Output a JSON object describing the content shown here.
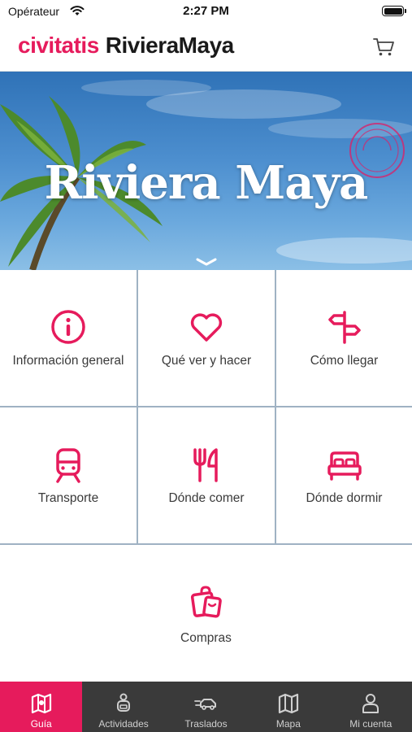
{
  "status_bar": {
    "carrier": "Opérateur",
    "time": "2:27 PM"
  },
  "header": {
    "brand": "civitatis",
    "destination": "RivieraMaya"
  },
  "hero": {
    "title": "Riviera Maya"
  },
  "menu": [
    {
      "label": "Información general",
      "icon": "info-icon"
    },
    {
      "label": "Qué ver y hacer",
      "icon": "heart-icon"
    },
    {
      "label": "Cómo llegar",
      "icon": "signpost-icon"
    },
    {
      "label": "Transporte",
      "icon": "train-icon"
    },
    {
      "label": "Dónde comer",
      "icon": "cutlery-icon"
    },
    {
      "label": "Dónde dormir",
      "icon": "bed-icon"
    },
    {
      "label": "Compras",
      "icon": "shopping-bag-icon"
    }
  ],
  "tabs": [
    {
      "label": "Guía",
      "icon": "map-guide-icon",
      "active": true
    },
    {
      "label": "Actividades",
      "icon": "backpacker-icon",
      "active": false
    },
    {
      "label": "Traslados",
      "icon": "transfer-car-icon",
      "active": false
    },
    {
      "label": "Mapa",
      "icon": "map-icon",
      "active": false
    },
    {
      "label": "Mi cuenta",
      "icon": "user-icon",
      "active": false
    }
  ],
  "colors": {
    "accent": "#e61b5c",
    "tab_bar": "#3a3a3a",
    "grid_lines": "#9fb2c3"
  }
}
